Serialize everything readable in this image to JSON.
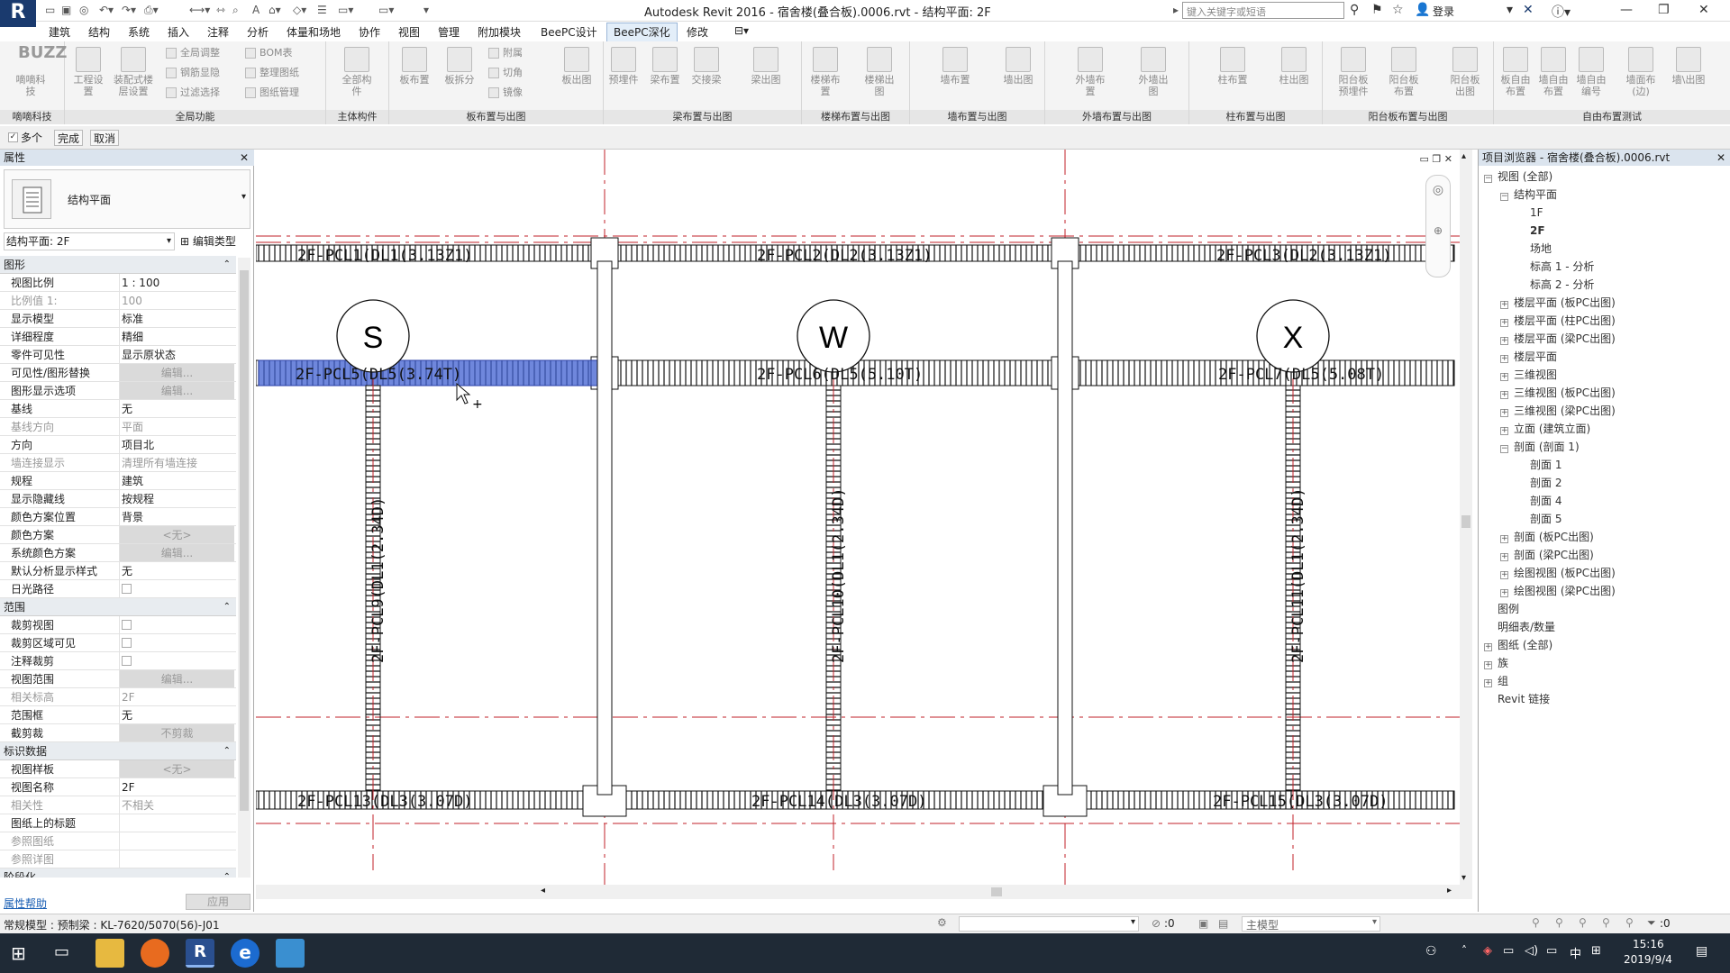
{
  "title_bar": {
    "app_logo": "R",
    "window_title": "Autodesk Revit 2016 -     宿舍楼(叠合板).0006.rvt - 结构平面: 2F",
    "search_placeholder": "键入关键字或短语",
    "login_label": "登录",
    "icons": [
      "binoculars-icon",
      "favorites-icon",
      "star-icon",
      "user-icon",
      "exchange-icon",
      "help-icon"
    ]
  },
  "menu": {
    "items": [
      "建筑",
      "结构",
      "系统",
      "插入",
      "注释",
      "分析",
      "体量和场地",
      "协作",
      "视图",
      "管理",
      "附加模块",
      "BeePC设计",
      "BeePC深化",
      "修改"
    ],
    "active_index": 12
  },
  "ribbon": {
    "groups": [
      {
        "label": "嘀嘀科技",
        "buttons": [
          "嘀嘀科技"
        ]
      },
      {
        "label": "全局功能",
        "buttons": [
          "工程设置",
          "装配式楼层设置"
        ],
        "small": [
          "全局调整",
          "钢筋显隐",
          "过滤选择",
          "BOM表",
          "整理图纸",
          "图纸管理"
        ]
      },
      {
        "label": "主体构件",
        "buttons": [
          "全部构件"
        ]
      },
      {
        "label": "板布置与出图",
        "buttons": [
          "板布置",
          "板拆分",
          "板出图"
        ],
        "small": [
          "附属",
          "切角",
          "镜像"
        ]
      },
      {
        "label": "梁布置与出图",
        "buttons": [
          "预埋件",
          "梁布置",
          "交接梁",
          "梁出图"
        ]
      },
      {
        "label": "楼梯布置与出图",
        "buttons": [
          "楼梯布置",
          "楼梯出图"
        ]
      },
      {
        "label": "墙布置与出图",
        "buttons": [
          "墙布置",
          "墙出图"
        ]
      },
      {
        "label": "外墙布置与出图",
        "buttons": [
          "外墙布置",
          "外墙出图"
        ]
      },
      {
        "label": "柱布置与出图",
        "buttons": [
          "柱布置",
          "柱出图"
        ]
      },
      {
        "label": "阳台板布置与出图",
        "buttons": [
          "阳台板预埋件",
          "阳台板布置",
          "阳台板出图"
        ]
      },
      {
        "label": "自由布置测试",
        "buttons": [
          "板自由布置",
          "墙自由布置",
          "墙自由编号",
          "墙面布(边)",
          "墙\\出图"
        ]
      }
    ]
  },
  "options_bar": {
    "multi_label": "多个",
    "finish_label": "完成",
    "cancel_label": "取消"
  },
  "properties": {
    "header": "属性",
    "type_name": "结构平面",
    "instance_selector": "结构平面: 2F",
    "edit_type_label": "编辑类型",
    "sections": [
      {
        "name": "图形",
        "rows": [
          {
            "k": "视图比例",
            "v": "1 : 100"
          },
          {
            "k": "比例值 1:",
            "v": "100",
            "dim": true
          },
          {
            "k": "显示模型",
            "v": "标准"
          },
          {
            "k": "详细程度",
            "v": "精细"
          },
          {
            "k": "零件可见性",
            "v": "显示原状态"
          },
          {
            "k": "可见性/图形替换",
            "v": "编辑...",
            "btn": true
          },
          {
            "k": "图形显示选项",
            "v": "编辑...",
            "btn": true
          },
          {
            "k": "基线",
            "v": "无"
          },
          {
            "k": "基线方向",
            "v": "平面",
            "dim": true
          },
          {
            "k": "方向",
            "v": "项目北"
          },
          {
            "k": "墙连接显示",
            "v": "清理所有墙连接",
            "dim": true
          },
          {
            "k": "规程",
            "v": "建筑"
          },
          {
            "k": "显示隐藏线",
            "v": "按规程"
          },
          {
            "k": "颜色方案位置",
            "v": "背景"
          },
          {
            "k": "颜色方案",
            "v": "<无>",
            "btn": true
          },
          {
            "k": "系统颜色方案",
            "v": "编辑...",
            "btn": true
          },
          {
            "k": "默认分析显示样式",
            "v": "无"
          },
          {
            "k": "日光路径",
            "v": "",
            "cb": true
          }
        ]
      },
      {
        "name": "范围",
        "rows": [
          {
            "k": "裁剪视图",
            "v": "",
            "cb": true
          },
          {
            "k": "裁剪区域可见",
            "v": "",
            "cb": true
          },
          {
            "k": "注释裁剪",
            "v": "",
            "cb": true
          },
          {
            "k": "视图范围",
            "v": "编辑...",
            "btn": true
          },
          {
            "k": "相关标高",
            "v": "2F",
            "dim": true
          },
          {
            "k": "范围框",
            "v": "无"
          },
          {
            "k": "截剪裁",
            "v": "不剪裁",
            "btn": true
          }
        ]
      },
      {
        "name": "标识数据",
        "rows": [
          {
            "k": "视图样板",
            "v": "<无>",
            "btn": true
          },
          {
            "k": "视图名称",
            "v": "2F"
          },
          {
            "k": "相关性",
            "v": "不相关",
            "dim": true
          },
          {
            "k": "图纸上的标题",
            "v": ""
          },
          {
            "k": "参照图纸",
            "v": "",
            "dim": true
          },
          {
            "k": "参照详图",
            "v": "",
            "dim": true
          }
        ]
      },
      {
        "name": "阶段化",
        "rows": []
      }
    ],
    "help_link": "属性帮助",
    "apply_label": "应用"
  },
  "drawing": {
    "grid_labels": [
      "S",
      "W",
      "X"
    ],
    "beam_tags_top": [
      "2F-PCL1(DL1(3.13Z1)",
      "2F-PCL2(DL2(3.13Z1)",
      "2F-PCL3(DL2(3.13Z1)"
    ],
    "beam_tags_mid": [
      "2F-PCL5(DL5(3.74T)",
      "2F-PCL6(DL5(5.10T)",
      "2F-PCL7(DL5(5.08T)"
    ],
    "beam_tags_bot": [
      "2F-PCL13(DL3(3.07D)",
      "2F-PCL14(DL3(3.07D)",
      "2F-PCL15(DL3(3.07D)"
    ],
    "beam_tags_vert": [
      "2F-PCL9(DL1(2.34D)",
      "2F-PCL10(DL1(2.34D)",
      "2F-PCL11(DL1(2.34D)"
    ],
    "selection_color": "#3f5fd0"
  },
  "project_browser": {
    "header": "项目浏览器 - 宿舍楼(叠合板).0006.rvt",
    "tree": [
      {
        "label": "视图 (全部)",
        "level": 0,
        "pm": "−"
      },
      {
        "label": "结构平面",
        "level": 1,
        "pm": "−"
      },
      {
        "label": "1F",
        "level": 2
      },
      {
        "label": "2F",
        "level": 2,
        "bold": true
      },
      {
        "label": "场地",
        "level": 2
      },
      {
        "label": "标高 1 - 分析",
        "level": 2
      },
      {
        "label": "标高 2 - 分析",
        "level": 2
      },
      {
        "label": "楼层平面 (板PC出图)",
        "level": 1,
        "pm": "+"
      },
      {
        "label": "楼层平面 (柱PC出图)",
        "level": 1,
        "pm": "+"
      },
      {
        "label": "楼层平面 (梁PC出图)",
        "level": 1,
        "pm": "+"
      },
      {
        "label": "楼层平面",
        "level": 1,
        "pm": "+"
      },
      {
        "label": "三维视图",
        "level": 1,
        "pm": "+"
      },
      {
        "label": "三维视图 (板PC出图)",
        "level": 1,
        "pm": "+"
      },
      {
        "label": "三维视图 (梁PC出图)",
        "level": 1,
        "pm": "+"
      },
      {
        "label": "立面 (建筑立面)",
        "level": 1,
        "pm": "+"
      },
      {
        "label": "剖面 (剖面 1)",
        "level": 1,
        "pm": "−"
      },
      {
        "label": "剖面 1",
        "level": 2
      },
      {
        "label": "剖面 2",
        "level": 2
      },
      {
        "label": "剖面 4",
        "level": 2
      },
      {
        "label": "剖面 5",
        "level": 2
      },
      {
        "label": "剖面 (板PC出图)",
        "level": 1,
        "pm": "+"
      },
      {
        "label": "剖面 (梁PC出图)",
        "level": 1,
        "pm": "+"
      },
      {
        "label": "绘图视图 (板PC出图)",
        "level": 1,
        "pm": "+"
      },
      {
        "label": "绘图视图 (梁PC出图)",
        "level": 1,
        "pm": "+"
      },
      {
        "label": "图例",
        "level": 0,
        "pm": " "
      },
      {
        "label": "明细表/数量",
        "level": 0,
        "pm": " "
      },
      {
        "label": "图纸 (全部)",
        "level": 0,
        "pm": "+"
      },
      {
        "label": "族",
        "level": 0,
        "pm": "+"
      },
      {
        "label": "组",
        "level": 0,
        "pm": "+"
      },
      {
        "label": "Revit 链接",
        "level": 0,
        "pm": " "
      }
    ]
  },
  "status_bar": {
    "text": "常规模型 : 预制梁 : KL-7620/5070(56)-J01",
    "zero1": ":0",
    "model_label": "主模型",
    "filter_count": ":0"
  },
  "taskbar": {
    "time": "15:16",
    "date": "2019/9/4",
    "ime": "中"
  }
}
